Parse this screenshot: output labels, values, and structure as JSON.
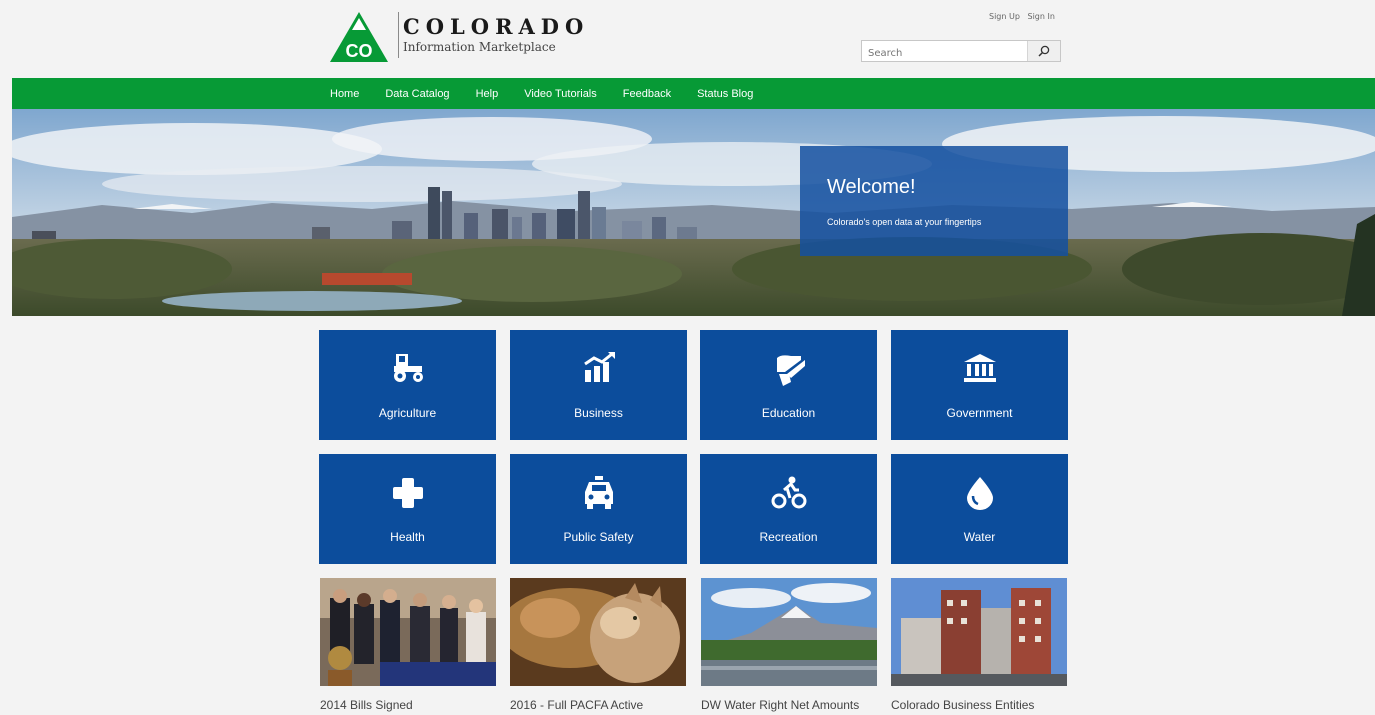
{
  "brand": {
    "logo_text": "CO",
    "title": "COLORADO",
    "subtitle": "Information Marketplace"
  },
  "auth": {
    "sign_up": "Sign Up",
    "sign_in": "Sign In"
  },
  "search": {
    "placeholder": "Search",
    "icon": "search-icon"
  },
  "nav": {
    "items": [
      {
        "label": "Home"
      },
      {
        "label": "Data Catalog"
      },
      {
        "label": "Help"
      },
      {
        "label": "Video Tutorials"
      },
      {
        "label": "Feedback"
      },
      {
        "label": "Status Blog"
      }
    ]
  },
  "hero": {
    "welcome_title": "Welcome!",
    "welcome_subtitle": "Colorado's open data at your fingertips"
  },
  "categories": [
    {
      "label": "Agriculture",
      "icon": "tractor-icon"
    },
    {
      "label": "Business",
      "icon": "chart-icon"
    },
    {
      "label": "Education",
      "icon": "pencil-book-icon"
    },
    {
      "label": "Government",
      "icon": "capitol-icon"
    },
    {
      "label": "Health",
      "icon": "medical-cross-icon"
    },
    {
      "label": "Public Safety",
      "icon": "police-car-icon"
    },
    {
      "label": "Recreation",
      "icon": "bicycle-icon"
    },
    {
      "label": "Water",
      "icon": "water-drop-icon"
    }
  ],
  "featured": [
    {
      "title": "2014 Bills Signed"
    },
    {
      "title": "2016 - Full PACFA Active"
    },
    {
      "title": "DW Water Right Net Amounts"
    },
    {
      "title": "Colorado Business Entities"
    }
  ],
  "colors": {
    "nav_green": "#079a36",
    "tile_blue": "#0c4d9c",
    "logo_green": "#079a36"
  }
}
